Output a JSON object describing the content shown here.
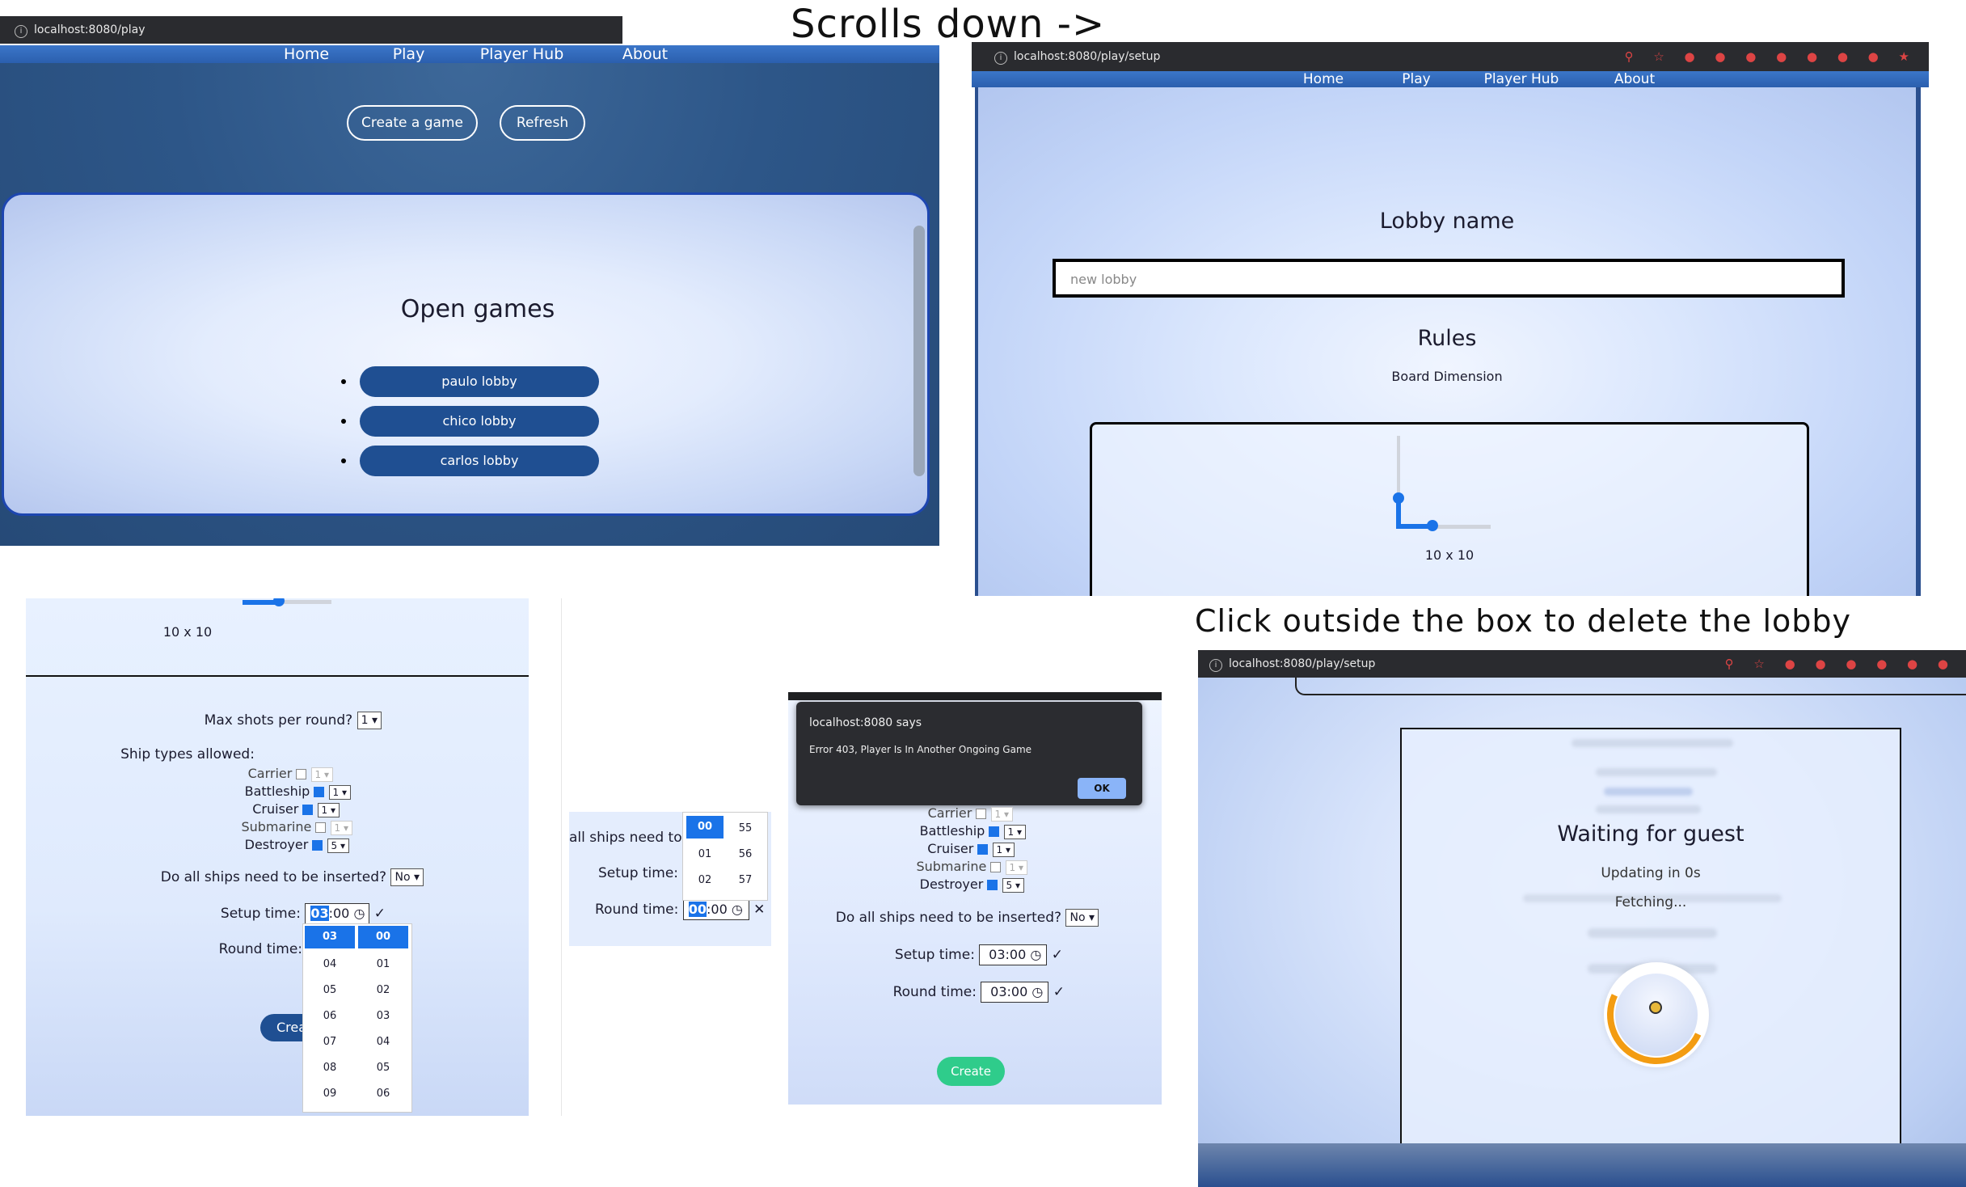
{
  "captions": {
    "scroll": "Scrolls down ->",
    "delete": "Click outside the box to delete the lobby"
  },
  "nav": [
    "Home",
    "Play",
    "Player Hub",
    "About"
  ],
  "panel1": {
    "url": "localhost:8080/play",
    "create_btn": "Create a game",
    "refresh_btn": "Refresh",
    "heading": "Open games",
    "lobbies": [
      "paulo lobby",
      "chico lobby",
      "carlos lobby"
    ]
  },
  "panel2": {
    "url": "localhost:8080/play/setup",
    "lobby_name_label": "Lobby name",
    "lobby_name_placeholder": "new lobby",
    "rules_label": "Rules",
    "board_dim_label": "Board Dimension",
    "board_dim_value": "10 x 10"
  },
  "panel3": {
    "board_dim_value": "10 x 10",
    "max_shots_label": "Max shots per round?",
    "max_shots_value": "1",
    "ship_types_label": "Ship types allowed:",
    "ships": [
      {
        "name": "Carrier",
        "checked": false,
        "count": "1"
      },
      {
        "name": "Battleship",
        "checked": true,
        "count": "1"
      },
      {
        "name": "Cruiser",
        "checked": true,
        "count": "1"
      },
      {
        "name": "Submarine",
        "checked": false,
        "count": "1"
      },
      {
        "name": "Destroyer",
        "checked": true,
        "count": "5"
      }
    ],
    "all_ships_label": "Do all ships need to be inserted?",
    "all_ships_value": "No",
    "setup_label": "Setup time:",
    "setup_hh": "03",
    "setup_mm": ":00",
    "round_label": "Round time:",
    "create_partial": "Crea",
    "picker_hours": [
      "03",
      "04",
      "05",
      "06",
      "07",
      "08",
      "09"
    ],
    "picker_minutes": [
      "00",
      "01",
      "02",
      "03",
      "04",
      "05",
      "06"
    ]
  },
  "panel4": {
    "all_ships_partial": "all ships need to b",
    "setup_label": "Setup time:",
    "round_label": "Round time:",
    "round_hh": "00",
    "round_mm": ":00",
    "picker_col1": [
      "00",
      "01",
      "02"
    ],
    "picker_col2": [
      "55",
      "56",
      "57"
    ],
    "check": "✓",
    "cross": "✕"
  },
  "panel5": {
    "dialog_title": "localhost:8080 says",
    "dialog_msg": "Error 403, Player Is In Another Ongoing Game",
    "dialog_ok": "OK",
    "ships": [
      {
        "name": "Carrier",
        "checked": false,
        "count": "1"
      },
      {
        "name": "Battleship",
        "checked": true,
        "count": "1"
      },
      {
        "name": "Cruiser",
        "checked": true,
        "count": "1"
      },
      {
        "name": "Submarine",
        "checked": false,
        "count": "1"
      },
      {
        "name": "Destroyer",
        "checked": true,
        "count": "5"
      }
    ],
    "all_ships_label": "Do all ships need to be inserted?",
    "all_ships_value": "No",
    "setup_label": "Setup time:",
    "setup_value": "03:00",
    "round_label": "Round time:",
    "round_value": "03:00",
    "create_btn": "Create"
  },
  "panel6": {
    "url": "localhost:8080/play/setup",
    "waiting": "Waiting for guest",
    "updating": "Updating in 0s",
    "fetching": "Fetching..."
  },
  "colors": {
    "nav": "#2b5fae",
    "dark_blue": "#2d5688",
    "light_bg": "#e6efff",
    "lobby_btn": "#1f4f92",
    "create_green": "#2fcc8b",
    "highlight": "#1a73e8",
    "spinner_orange": "#f39c12"
  }
}
